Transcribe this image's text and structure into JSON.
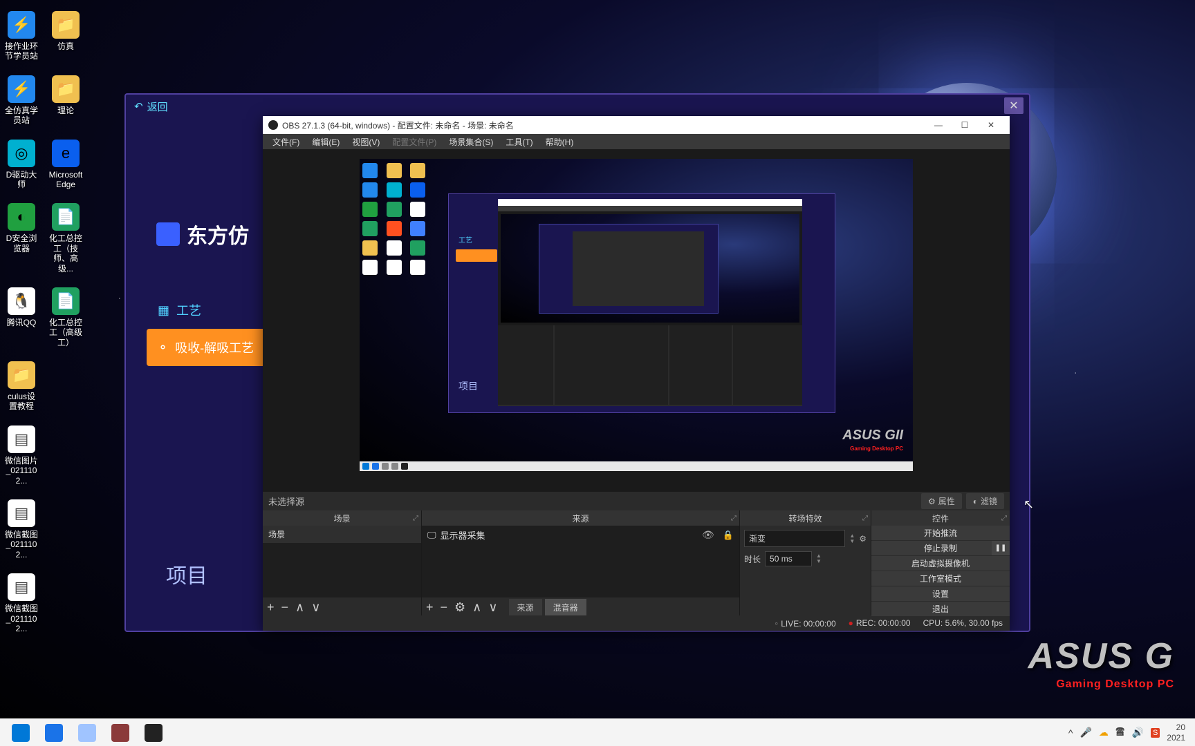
{
  "wallpaper": {
    "brand": "ASUS G",
    "brand_sub": "Gaming Desktop PC"
  },
  "desktop_icons": [
    [
      {
        "label": "接作业环节学员站",
        "cls": "ic-blue",
        "g": "⚡"
      },
      {
        "label": "仿真",
        "cls": "ic-folder",
        "g": "📁"
      }
    ],
    [
      {
        "label": "全仿真学员站",
        "cls": "ic-blue",
        "g": "⚡"
      },
      {
        "label": "理论",
        "cls": "ic-folder",
        "g": "📁"
      }
    ],
    [
      {
        "label": "D驱动大师",
        "cls": "ic-cyan",
        "g": "◎"
      },
      {
        "label": "Microsoft Edge",
        "cls": "ic-edge",
        "g": "e"
      }
    ],
    [
      {
        "label": "D安全浏览器",
        "cls": "ic-green",
        "g": "◐"
      },
      {
        "label": "化工总控工（技师、高级...",
        "cls": "ic-pdf",
        "g": "📄"
      }
    ],
    [
      {
        "label": "腾讯QQ",
        "cls": "ic-qq",
        "g": "🐧"
      },
      {
        "label": "化工总控工（高级工）",
        "cls": "ic-pdf",
        "g": "📄"
      }
    ],
    [
      {
        "label": "culus设置教程",
        "cls": "ic-folder",
        "g": "📁"
      }
    ],
    [
      {
        "label": "微信图片_0211102...",
        "cls": "ic-white",
        "g": "▤"
      }
    ],
    [
      {
        "label": "微信截图_0211102...",
        "cls": "ic-white",
        "g": "▤"
      }
    ],
    [
      {
        "label": "微信截图_0211102...",
        "cls": "ic-white",
        "g": "▤"
      }
    ]
  ],
  "purple_app": {
    "back": "返回",
    "title": "东方仿",
    "tab_tech": "工艺",
    "tab_abs": "吸收-解吸工艺",
    "project": "项目"
  },
  "obs": {
    "title": "OBS 27.1.3 (64-bit, windows) - 配置文件: 未命名 - 场景: 未命名",
    "menu": {
      "file": "文件(F)",
      "edit": "编辑(E)",
      "view": "视图(V)",
      "profile": "配置文件(P)",
      "scene_col": "场景集合(S)",
      "tools": "工具(T)",
      "help": "帮助(H)"
    },
    "no_source": "未选择源",
    "btn_props": "属性",
    "btn_filters": "滤镜",
    "panel_scenes": "场景",
    "panel_sources": "来源",
    "panel_trans": "转场特效",
    "panel_ctrl": "控件",
    "scene_item": "场景",
    "src_item": "显示器采集",
    "src_tab_src": "来源",
    "src_tab_mixer": "混音器",
    "trans_type": "渐变",
    "trans_dur_lbl": "时长",
    "trans_dur_val": "50 ms",
    "ctrl": {
      "stream": "开始推流",
      "rec": "停止录制",
      "vcam": "启动虚拟摄像机",
      "studio": "工作室模式",
      "settings": "设置",
      "exit": "退出"
    },
    "status": {
      "live": "LIVE: 00:00:00",
      "rec": "REC: 00:00:00",
      "cpu": "CPU: 5.6%, 30.00 fps"
    }
  },
  "preview": {
    "brand": "ASUS GII",
    "brand_sub": "Gaming Desktop PC",
    "pproj": "项目",
    "ptab": "工艺"
  },
  "taskbar": {
    "time": "20",
    "date": "2021",
    "items": [
      {
        "name": "start",
        "bg": "#0078d7"
      },
      {
        "name": "edge",
        "bg": "#1a73e8"
      },
      {
        "name": "calculator",
        "bg": "#a0c4ff"
      },
      {
        "name": "app1",
        "bg": "#8b3a3a"
      },
      {
        "name": "obs",
        "bg": "#222"
      }
    ]
  }
}
